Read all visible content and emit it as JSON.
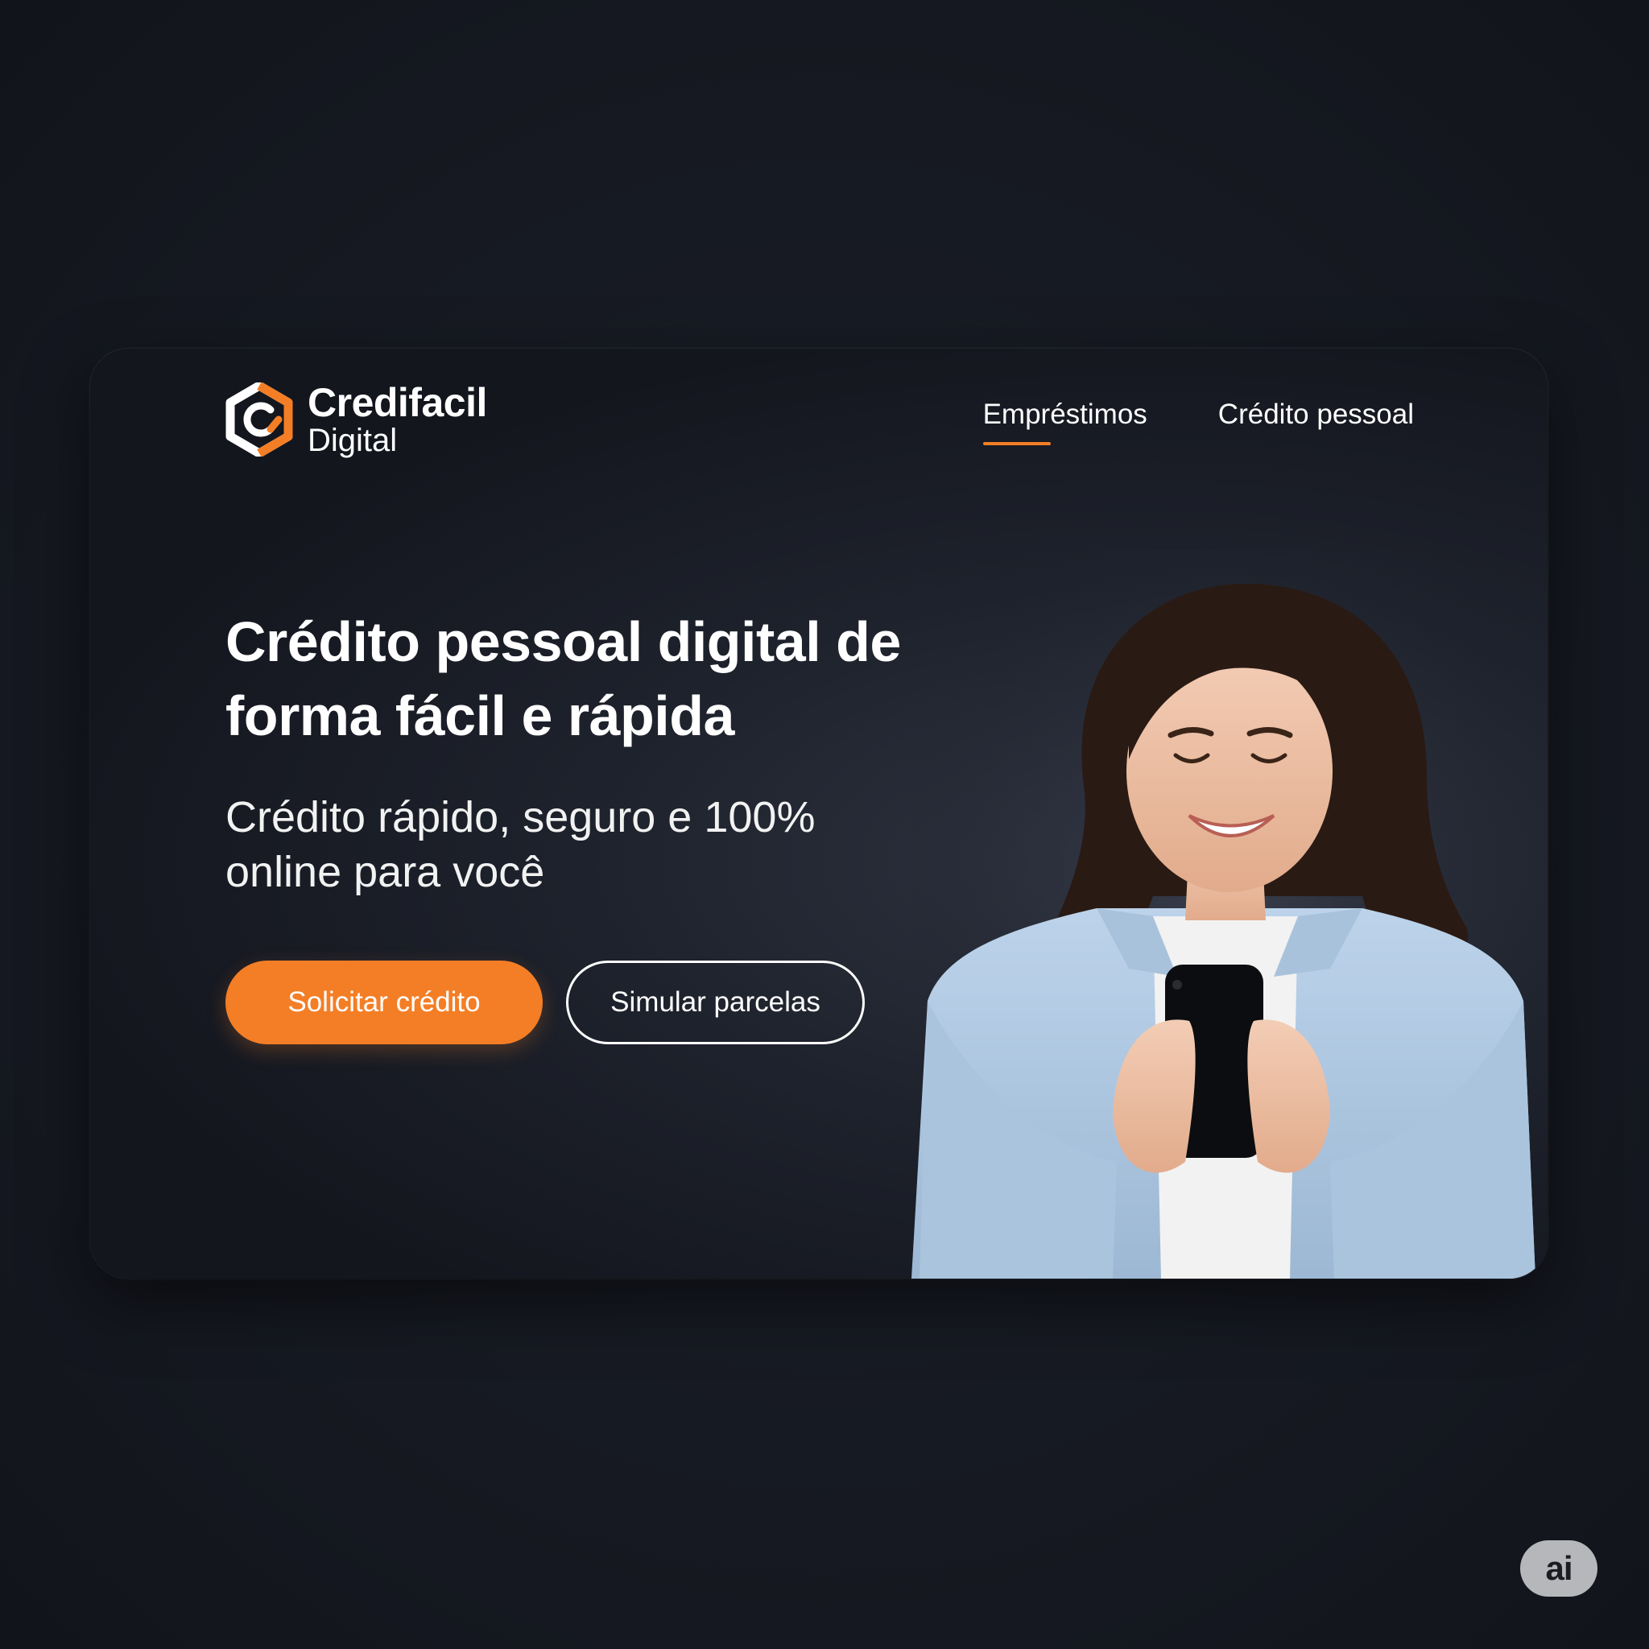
{
  "brand": {
    "name": "Credifacil",
    "sub": "Digital",
    "accent_color": "#f47e25",
    "icon": "credifacil-logo-icon"
  },
  "nav": {
    "items": [
      {
        "label": "Empréstimos",
        "active": true
      },
      {
        "label": "Crédito pessoal",
        "active": false
      }
    ]
  },
  "hero": {
    "headline": "Crédito pessoal digital de forma fácil e rápida",
    "subtitle": "Crédito rápido, seguro e 100% online para você",
    "primary_button": "Solicitar crédito",
    "secondary_button": "Simular parcelas",
    "image": "woman-smiling-with-phone-illustration"
  },
  "badge": {
    "label": "ai"
  }
}
